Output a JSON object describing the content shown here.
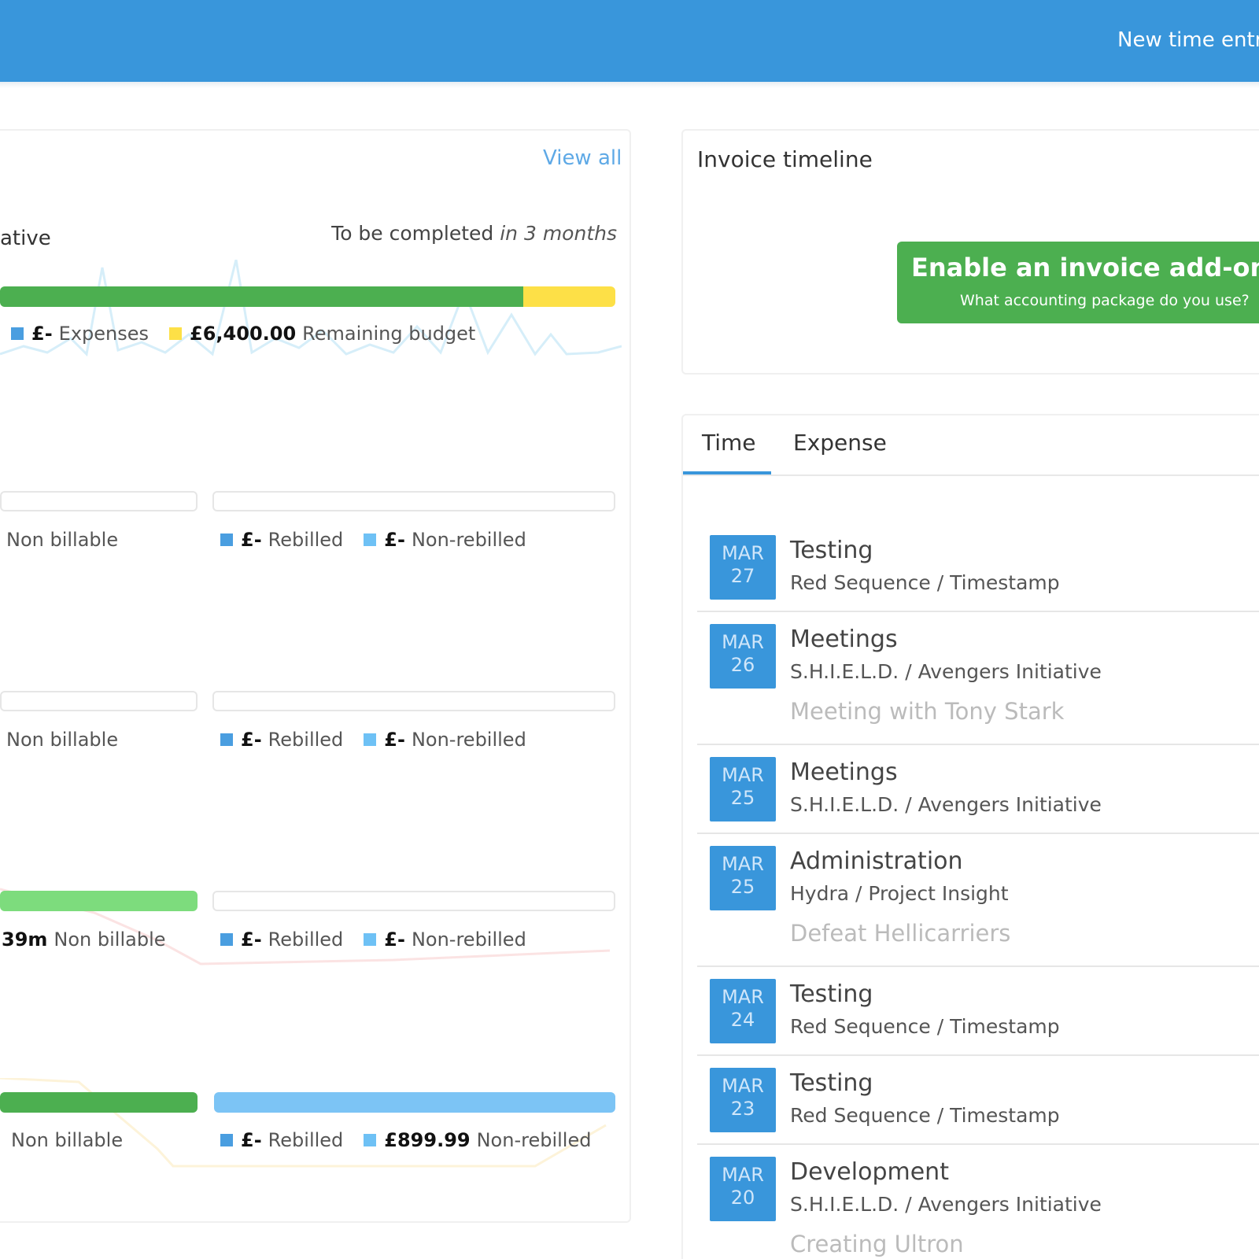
{
  "header": {
    "new_time_entry": "New time entry"
  },
  "project_card": {
    "view_all": "View all",
    "project_name_fragment": "ative",
    "completion_prefix": "To be completed ",
    "completion_time": "in 3 months",
    "budget": {
      "expenses_amount": "£-",
      "expenses_label": "Expenses",
      "remaining_amount": "£6,400.00",
      "remaining_label": "Remaining budget",
      "used_fraction": 0.85
    },
    "rows": [
      {
        "nb_amount": "",
        "nb_label": "Non billable",
        "rebilled_amount": "£-",
        "rebilled_label": "Rebilled",
        "nonrebilled_amount": "£-",
        "nonrebilled_label": "Non-rebilled"
      },
      {
        "nb_amount": "",
        "nb_label": "Non billable",
        "rebilled_amount": "£-",
        "rebilled_label": "Rebilled",
        "nonrebilled_amount": "£-",
        "nonrebilled_label": "Non-rebilled"
      },
      {
        "nb_amount": "39m",
        "nb_label": "Non billable",
        "rebilled_amount": "£-",
        "rebilled_label": "Rebilled",
        "nonrebilled_amount": "£-",
        "nonrebilled_label": "Non-rebilled"
      },
      {
        "nb_amount": "",
        "nb_label": "Non billable",
        "rebilled_amount": "£-",
        "rebilled_label": "Rebilled",
        "nonrebilled_amount": "£899.99",
        "nonrebilled_label": "Non-rebilled"
      }
    ]
  },
  "invoice": {
    "title": "Invoice timeline",
    "addon_title": "Enable an invoice add-on n",
    "addon_sub": "What accounting package do you use?"
  },
  "tabs": {
    "time": "Time",
    "expense": "Expense"
  },
  "entries": [
    {
      "month": "MAR",
      "day": "27",
      "task": "Testing",
      "project": "Red Sequence / Timestamp",
      "note": ""
    },
    {
      "month": "MAR",
      "day": "26",
      "task": "Meetings",
      "project": "S.H.I.E.L.D. / Avengers Initiative",
      "note": "Meeting with Tony Stark"
    },
    {
      "month": "MAR",
      "day": "25",
      "task": "Meetings",
      "project": "S.H.I.E.L.D. / Avengers Initiative",
      "note": ""
    },
    {
      "month": "MAR",
      "day": "25",
      "task": "Administration",
      "project": "Hydra / Project Insight",
      "note": "Defeat Hellicarriers"
    },
    {
      "month": "MAR",
      "day": "24",
      "task": "Testing",
      "project": "Red Sequence / Timestamp",
      "note": ""
    },
    {
      "month": "MAR",
      "day": "23",
      "task": "Testing",
      "project": "Red Sequence / Timestamp",
      "note": ""
    },
    {
      "month": "MAR",
      "day": "20",
      "task": "Development",
      "project": "S.H.I.E.L.D. / Avengers Initiative",
      "note": "Creating Ultron"
    }
  ],
  "colors": {
    "header_blue": "#3996db",
    "budget_green": "#4caf50",
    "budget_yellow": "#fde047",
    "light_green": "#7ddc7d",
    "light_blue": "#7cc4f5",
    "legend_blue": "#4a9ee0",
    "legend_light_blue": "#6ec1f5"
  }
}
